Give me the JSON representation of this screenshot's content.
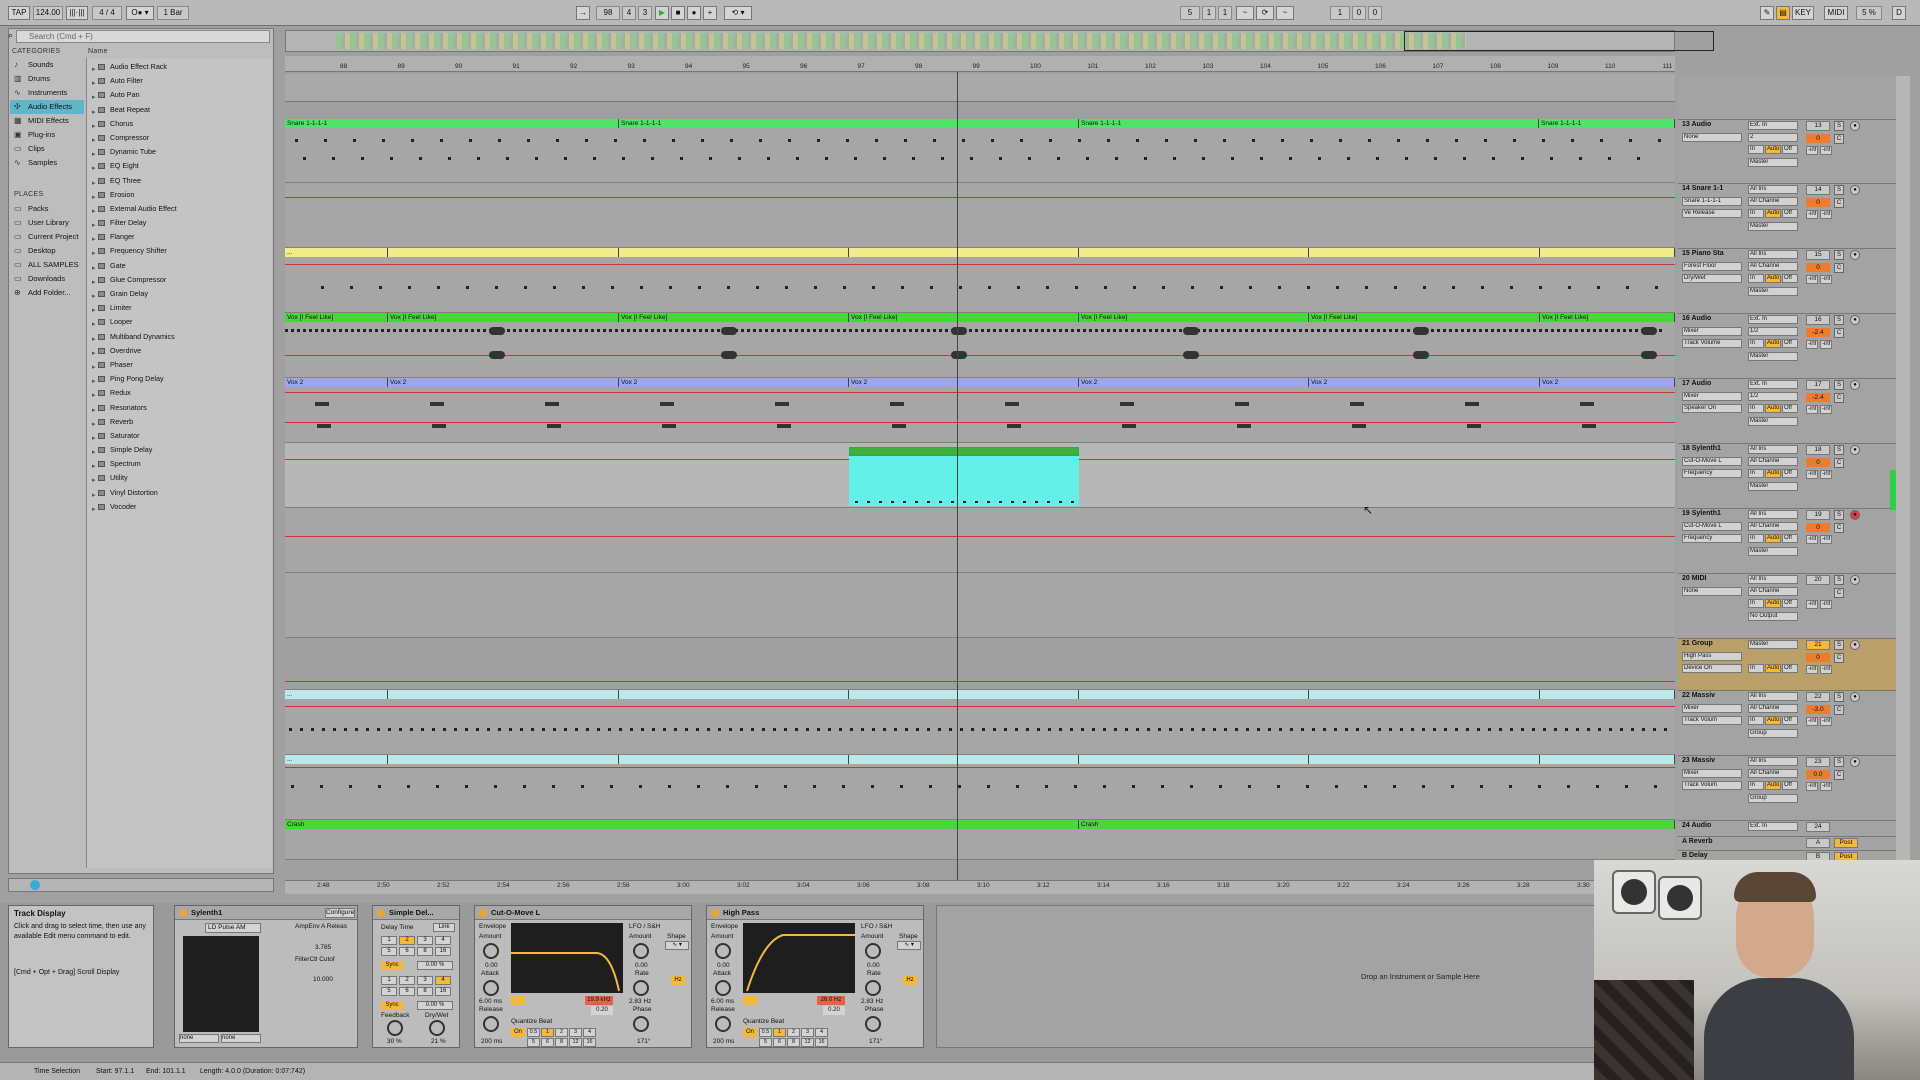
{
  "transport": {
    "tap": "TAP",
    "tempo": "124.00",
    "sig": "4 / 4",
    "quant": "1 Bar",
    "position": [
      "98",
      "4",
      "3"
    ],
    "loop_start": [
      "5",
      "1",
      "1"
    ],
    "loop_len": [
      "1",
      "0",
      "0"
    ],
    "key": "KEY",
    "midi": "MIDI",
    "cpu": "5 %",
    "d": "D"
  },
  "browser": {
    "search_placeholder": "Search (Cmd + F)",
    "categories_header": "CATEGORIES",
    "name_header": "Name",
    "categories": [
      "Sounds",
      "Drums",
      "Instruments",
      "Audio Effects",
      "MIDI Effects",
      "Plug-ins",
      "Clips",
      "Samples"
    ],
    "places_header": "PLACES",
    "places": [
      "Packs",
      "User Library",
      "Current Project",
      "Desktop",
      "ALL SAMPLES",
      "Downloads",
      "Add Folder..."
    ],
    "items": [
      "Audio Effect Rack",
      "Auto Filter",
      "Auto Pan",
      "Beat Repeat",
      "Chorus",
      "Compressor",
      "Dynamic Tube",
      "EQ Eight",
      "EQ Three",
      "Erosion",
      "External Audio Effect",
      "Filter Delay",
      "Flanger",
      "Frequency Shifter",
      "Gate",
      "Glue Compressor",
      "Grain Delay",
      "Limiter",
      "Looper",
      "Multiband Dynamics",
      "Overdrive",
      "Phaser",
      "Ping Pong Delay",
      "Redux",
      "Resonators",
      "Reverb",
      "Saturator",
      "Simple Delay",
      "Spectrum",
      "Utility",
      "Vinyl Distortion",
      "Vocoder"
    ]
  },
  "ruler": [
    "88",
    "89",
    "90",
    "91",
    "92",
    "93",
    "94",
    "95",
    "96",
    "97",
    "98",
    "99",
    "100",
    "101",
    "102",
    "103",
    "104",
    "105",
    "106",
    "107",
    "108",
    "109",
    "110",
    "111"
  ],
  "timeline": [
    "2:48",
    "2:50",
    "2:52",
    "2:54",
    "2:56",
    "2:58",
    "3:00",
    "3:02",
    "3:04",
    "3:06",
    "3:08",
    "3:10",
    "3:12",
    "3:14",
    "3:16",
    "3:18",
    "3:20",
    "3:22",
    "3:24",
    "3:26",
    "3:28",
    "3:30"
  ],
  "clips": {
    "snare": "Snare 1-1-1-1",
    "vox": "Vox [I Feel Like]",
    "vox2": "Vox 2",
    "crash": "Crash",
    "dots": "..."
  },
  "tracks": [
    {
      "name": "13 Audio",
      "in": "Ext. In",
      "ch": "2",
      "dev": "None",
      "num": "13",
      "vol": "0",
      "out": "Master"
    },
    {
      "name": "14 Snare 1-1",
      "in": "All Ins",
      "ch": "All Channe",
      "dev": "Snare 1-1-1-1",
      "par": "Ve Release",
      "num": "14",
      "vol": "0",
      "out": "Master"
    },
    {
      "name": "15 Piano Sta",
      "in": "All Ins",
      "ch": "All Channe",
      "dev": "Forest Floor",
      "par": "Dry/Wet",
      "num": "15",
      "vol": "0",
      "out": "Master"
    },
    {
      "name": "16 Audio",
      "in": "Ext. In",
      "ch": "1/2",
      "dev": "Mixer",
      "par": "Track Volume",
      "num": "16",
      "vol": "-2.4",
      "out": "Master"
    },
    {
      "name": "17 Audio",
      "in": "Ext. In",
      "ch": "1/2",
      "dev": "Mixer",
      "par": "Speaker On",
      "num": "17",
      "vol": "-2.4",
      "out": "Master"
    },
    {
      "name": "18 Sylenth1",
      "in": "All Ins",
      "ch": "All Channe",
      "dev": "Cut-O-Move L",
      "par": "Frequency",
      "num": "18",
      "vol": "0",
      "out": "Master"
    },
    {
      "name": "19 Sylenth1",
      "in": "All Ins",
      "ch": "All Channe",
      "dev": "Cut-O-Move L",
      "par": "Frequency",
      "num": "19",
      "vol": "0",
      "out": "Master"
    },
    {
      "name": "20 MIDI",
      "in": "All Ins",
      "ch": "All Channe",
      "dev": "None",
      "num": "20",
      "vol": "",
      "out": "No Output"
    },
    {
      "name": "21 Group",
      "in": "Master",
      "ch": "",
      "dev": "High Pass",
      "par": "Device On",
      "num": "21",
      "vol": "0",
      "out": ""
    },
    {
      "name": "22 Massiv",
      "in": "All Ins",
      "ch": "All Channe",
      "dev": "Mixer",
      "par": "Track Volum",
      "num": "22",
      "vol": "-3.0",
      "out": "Group"
    },
    {
      "name": "23 Massiv",
      "in": "All Ins",
      "ch": "All Channe",
      "dev": "Mixer",
      "par": "Track Volum",
      "num": "23",
      "vol": "0.0",
      "out": "Group"
    },
    {
      "name": "24 Audio",
      "in": "Ext. In",
      "ch": "",
      "dev": "",
      "num": "24",
      "vol": "0",
      "out": ""
    },
    {
      "name": "A Reverb",
      "in": "",
      "ch": "",
      "dev": "",
      "num": "A",
      "vol": "",
      "out": "Post"
    },
    {
      "name": "B Delay",
      "in": "",
      "ch": "",
      "dev": "",
      "num": "B",
      "vol": "",
      "out": "Post"
    }
  ],
  "inauto": [
    "In",
    "Auto",
    "Off"
  ],
  "ms": [
    "S",
    "C"
  ],
  "inf": "-inf",
  "info": {
    "title": "Track Display",
    "body": "Click and drag to select time, then use any available Edit menu command to edit.",
    "shortcut": "[Cmd + Opt + Drag] Scroll Display"
  },
  "devices": {
    "sylenth": {
      "title": "Sylenth1",
      "configure": "Configure",
      "preset": "LD Pulse AM",
      "p1": "AmpEnv A Releas",
      "v1": "3.785",
      "p2": "FilterCtl Cutof",
      "v2": "10.000",
      "none1": "none",
      "none2": "none"
    },
    "delay": {
      "title": "Simple Del...",
      "delay_time": "Delay Time",
      "link": "Link",
      "sync": "Sync",
      "pct": "0.00 %",
      "feedback": "Feedback",
      "drywet": "Dry/Wet",
      "fb_val": "30 %",
      "dw_val": "21 %",
      "grid": [
        "1",
        "2",
        "3",
        "4",
        "5",
        "6",
        "8",
        "16"
      ]
    },
    "cutomove": {
      "title": "Cut-O-Move L",
      "envelope": "Envelope",
      "amount": "Amount",
      "attack": "Attack",
      "release": "Release",
      "att_val": "6.00 ms",
      "rel_val": "200 ms",
      "freq": "19.9 kHz",
      "q": "0.20",
      "lfo": "LFO / S&H",
      "shape": "Shape",
      "amt2": "Amount",
      "rate": "Rate",
      "rate_val": "2.83 Hz",
      "phase": "Phase",
      "phase_val": "171°",
      "hz": "Hz",
      "quantize": "Quantize Beat",
      "on": "On",
      "qgrid": [
        "0.5",
        "1",
        "2",
        "3",
        "4",
        "5",
        "6",
        "8",
        "12",
        "16"
      ],
      "zero": "0.00"
    },
    "highpass": {
      "title": "High Pass",
      "envelope": "Envelope",
      "amount": "Amount",
      "attack": "Attack",
      "release": "Release",
      "att_val": "6.00 ms",
      "rel_val": "200 ms",
      "freq": "26.0 Hz",
      "q": "0.20",
      "lfo": "LFO / S&H",
      "shape": "Shape",
      "amt2": "Amount",
      "rate": "Rate",
      "rate_val": "2.83 Hz",
      "phase": "Phase",
      "phase_val": "171°",
      "hz": "Hz",
      "quantize": "Quantize Beat",
      "on": "On",
      "qgrid": [
        "0.5",
        "1",
        "2",
        "3",
        "4",
        "5",
        "6",
        "8",
        "12",
        "16"
      ],
      "zero": "0.00"
    },
    "drop": "Drop an Instrument or Sample Here"
  },
  "status": {
    "sel": "Time Selection",
    "start": "Start: 97.1.1",
    "end": "End: 101.1.1",
    "length": "Length: 4.0.0 (Duration: 0:07:742)"
  },
  "colors": {
    "green": "#4fe36a",
    "yellow": "#f0ec8a",
    "lime": "#49d63a",
    "blue": "#9ea5ec",
    "cyan": "#62f0e8",
    "orange": "#f1a43c",
    "lightblue": "#bde8ea"
  }
}
